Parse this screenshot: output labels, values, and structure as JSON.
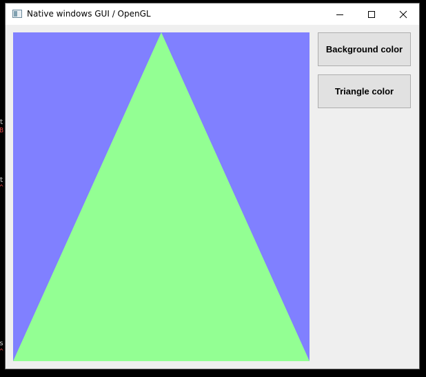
{
  "window": {
    "title": "Native windows GUI / OpenGL",
    "icon": "app-window-icon",
    "controls": [
      "minimize-icon",
      "maximize-icon",
      "close-icon"
    ]
  },
  "canvas": {
    "background_color": "#8080ff",
    "triangle_color": "#93ff93"
  },
  "buttons": {
    "background_color_label": "Background color",
    "triangle_color_label": "Triangle color"
  },
  "behind_window_fragments": [
    {
      "text": "t",
      "color": "#cfcfcf"
    },
    {
      "text": "B",
      "color": "#e04848"
    },
    {
      "text": "t",
      "color": "#cfcfcf"
    },
    {
      "text": "^",
      "color": "#e04848"
    },
    {
      "text": "s",
      "color": "#cfcfcf"
    },
    {
      "text": "^",
      "color": "#e04848"
    }
  ]
}
